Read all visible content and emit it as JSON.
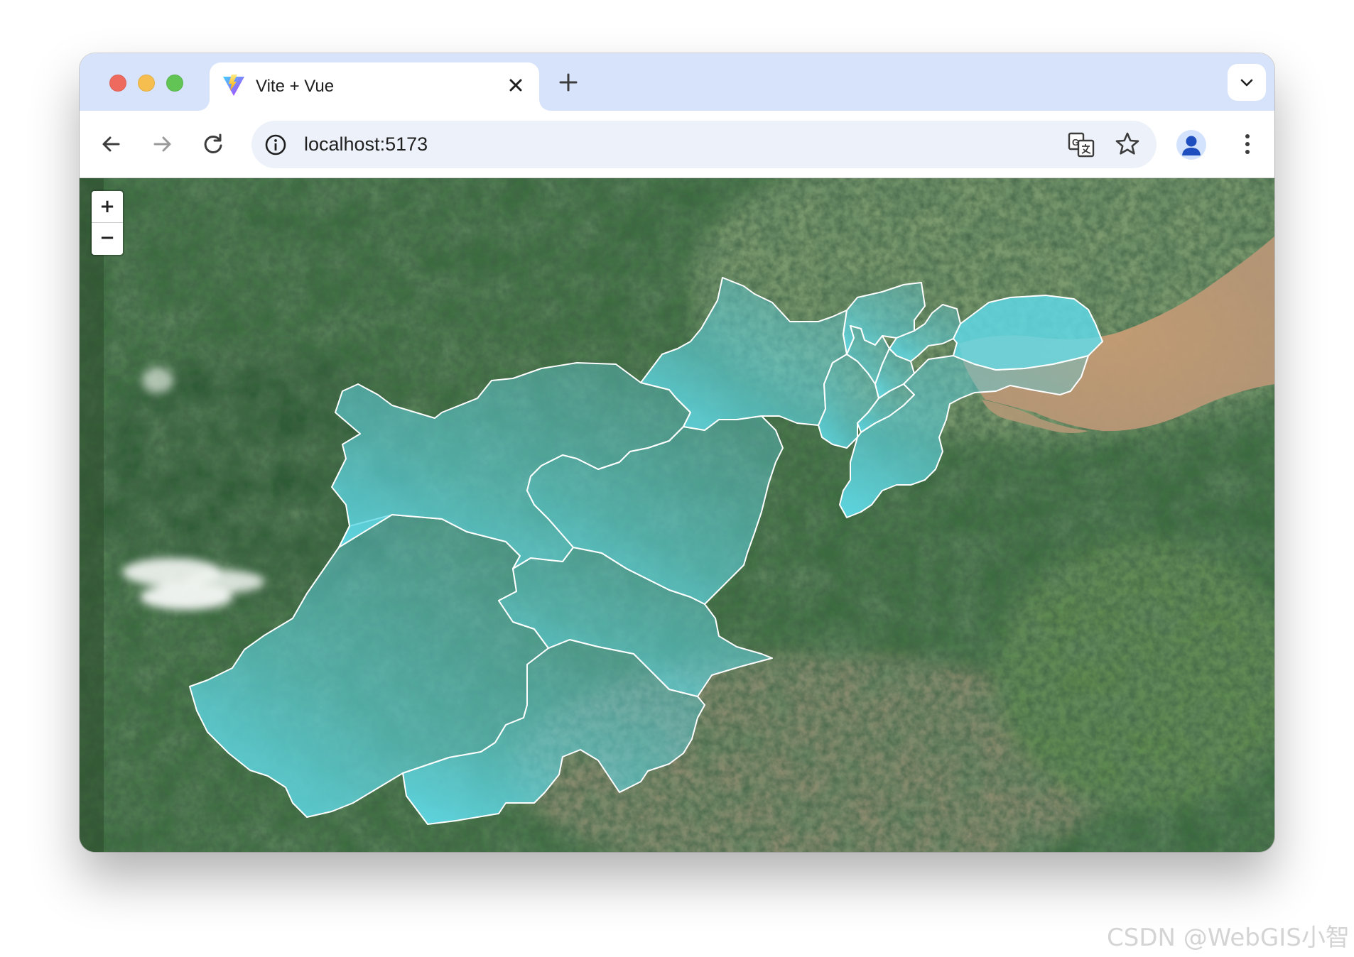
{
  "browser": {
    "tab": {
      "title": "Vite + Vue",
      "favicon": "vite-logo-icon",
      "close_icon": "close-icon"
    },
    "new_tab_icon": "plus-icon",
    "tab_search_icon": "chevron-down-icon",
    "toolbar": {
      "back_icon": "arrow-left-icon",
      "forward_icon": "arrow-right-icon",
      "reload_icon": "reload-icon",
      "forward_enabled": false
    },
    "address_bar": {
      "url": "localhost:5173",
      "site_info_icon": "info-icon",
      "translate_icon": "translate-icon",
      "bookmark_icon": "star-icon"
    },
    "profile_icon": "account-icon",
    "menu_icon": "more-vert-icon"
  },
  "map": {
    "basemap": "satellite-imagery",
    "zoom_in_label": "+",
    "zoom_out_label": "−",
    "layer": {
      "fill_color": "#5fdcea",
      "stroke_color": "#ffffff"
    }
  },
  "watermark": "CSDN @WebGIS小智"
}
